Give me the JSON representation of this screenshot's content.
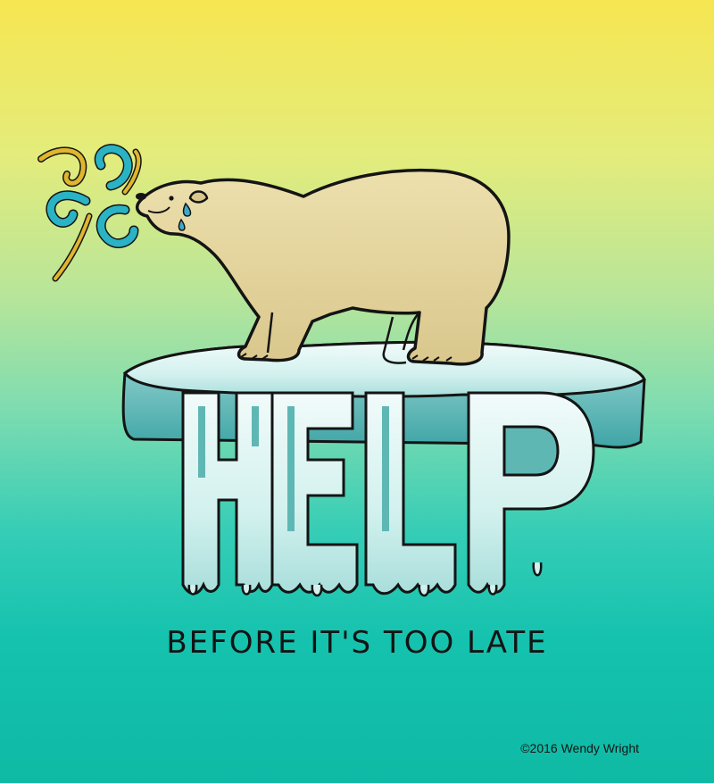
{
  "artwork": {
    "headline": "HELP",
    "tagline": "BEFORE IT'S TOO LATE",
    "credit": "©2016 Wendy Wright"
  },
  "colors": {
    "bg_top": "#f6e651",
    "bg_bottom": "#0fbaa5",
    "bear": "#e6d8a3",
    "ice": "#c7eeea",
    "ice_shadow": "#5fb7b4",
    "swirl_gold": "#e0b62e",
    "swirl_blue": "#2ab3c4",
    "tear": "#3fa9c9",
    "ink": "#141414"
  },
  "icons": [
    "polar-bear-icon",
    "breath-swirl-icon",
    "tear-drop-icon",
    "ice-floe-icon"
  ]
}
